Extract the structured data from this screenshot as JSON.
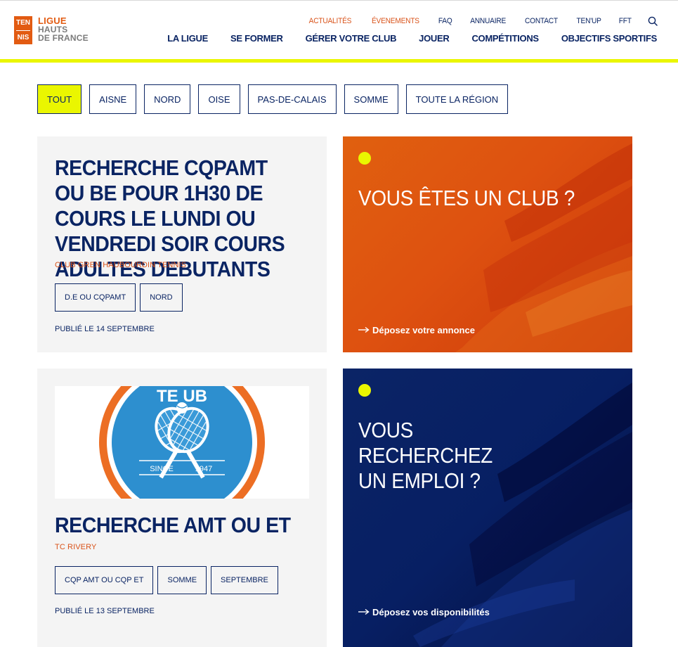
{
  "logo": {
    "box_top": "TEN",
    "box_bottom": "NIS",
    "line1": "LIGUE",
    "line2": "HAUTS",
    "line3": "DE FRANCE"
  },
  "topnav": [
    "ACTUALITÉS",
    "ÉVENEMENTS",
    "FAQ",
    "ANNUAIRE",
    "CONTACT",
    "TEN'UP",
    "FFT"
  ],
  "mainnav": [
    "LA LIGUE",
    "SE FORMER",
    "GÉRER VOTRE CLUB",
    "JOUER",
    "COMPÉTITIONS",
    "OBJECTIFS SPORTIFS"
  ],
  "filters": [
    "TOUT",
    "AISNE",
    "NORD",
    "OISE",
    "PAS-DE-CALAIS",
    "SOMME",
    "TOUTE LA RÉGION"
  ],
  "cards": [
    {
      "title": "RECHERCHE CQPAMT OU BE POUR 1H30 DE COURS LE LUNDI OU VENDREDI SOIR COURS ADULTES DEBUTANTS",
      "club": "CLUB GREN HAUBOURDIN TENNIS",
      "tags": [
        "D.E OU CQPAMT",
        "NORD"
      ],
      "published": "PUBLIÉ LE 14 SEPTEMBRE"
    },
    {
      "title": "RECHERCHE AMT OU ET",
      "club": "TC RIVERY",
      "tags": [
        "CQP AMT OU CQP ET",
        "SOMME",
        "SEPTEMBRE"
      ],
      "published": "PUBLIÉ LE 13 SEPTEMBRE",
      "logo_text": {
        "since": "SINCE",
        "year": "1947",
        "arc": "TE    UB"
      }
    }
  ],
  "promos": [
    {
      "title": "VOUS ÊTES UN CLUB ?",
      "link": "Déposez votre annonce"
    },
    {
      "title_line1": "VOUS RECHERCHEZ",
      "title_line2": "UN EMPLOI ?",
      "link": "Déposez vos disponibilités"
    }
  ],
  "colors": {
    "navy": "#0a2463",
    "orange": "#e25b12",
    "yellow": "#eaf600",
    "card_bg": "#f4f4f4"
  }
}
